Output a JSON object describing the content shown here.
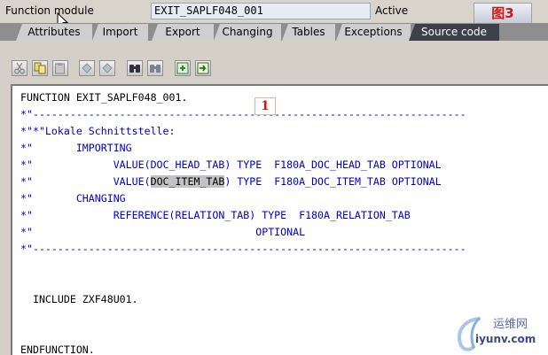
{
  "header": {
    "function_module_label": "Function module",
    "function_module_value": "EXIT_SAPLF048_001",
    "status": "Active",
    "figure_label": "图3"
  },
  "tabs": [
    {
      "label": "Attributes"
    },
    {
      "label": "Import"
    },
    {
      "label": "Export"
    },
    {
      "label": "Changing"
    },
    {
      "label": "Tables"
    },
    {
      "label": "Exceptions"
    },
    {
      "label": "Source code",
      "selected": true
    }
  ],
  "toolbar": {
    "buttons": [
      "cut-icon",
      "copy-icon",
      "paste-icon",
      "undo-icon",
      "redo-icon",
      "find-icon",
      "find-next-icon",
      "insert-statement-icon",
      "pattern-icon"
    ]
  },
  "code": {
    "line1": "FUNCTION EXIT_SAPLF048_001.",
    "line2": "*\"----------------------------------------------------------------------",
    "line3": "*\"*\"Lokale Schnittstelle:",
    "line4a": "*\"       IMPORTING",
    "line5a": "*\"             VALUE(DOC_HEAD_TAB) TYPE  F180A_DOC_HEAD_TAB OPTIONAL",
    "line6_pre": "*\"             VALUE(",
    "line6_hl": "DOC_ITEM_TAB",
    "line6_post": ") TYPE  F180A_DOC_ITEM_TAB OPTIONAL",
    "line7": "*\"       CHANGING",
    "line8": "*\"             REFERENCE(RELATION_TAB) TYPE  F180A_RELATION_TAB",
    "line9": "*\"                                    OPTIONAL",
    "line10": "*\"----------------------------------------------------------------------",
    "line11": "  INCLUDE ZXF48U01.",
    "line12": "ENDFUNCTION."
  },
  "annotation": "1",
  "watermark": {
    "top": "运维网",
    "bottom": "iyunv.com"
  },
  "colors": {
    "comment": "#0000c8",
    "tab_selected": "#3c4048",
    "annotation": "#d01818"
  }
}
